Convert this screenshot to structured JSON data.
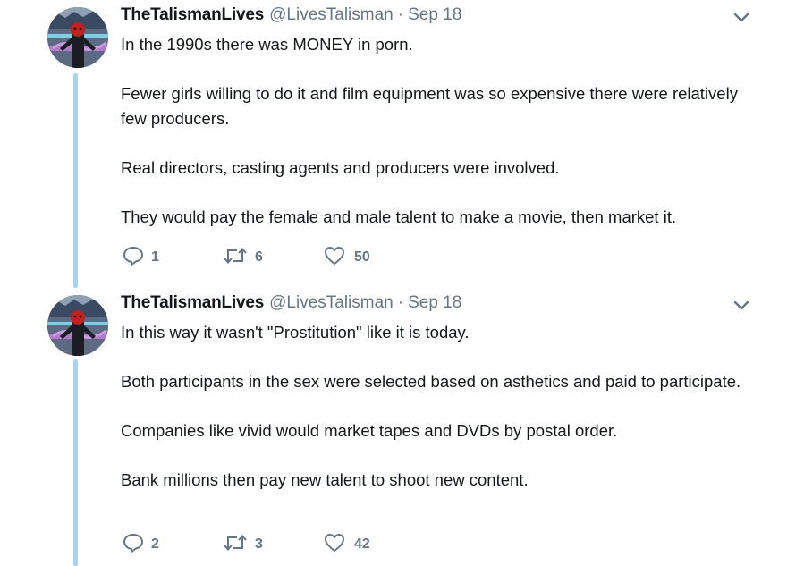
{
  "tweets": [
    {
      "display_name": "TheTalismanLives",
      "handle": "@LivesTalisman",
      "separator": "·",
      "date": "Sep 18",
      "paragraphs": [
        "In the 1990s there was MONEY in porn.",
        "Fewer girls willing to do it and film equipment was so expensive there were relatively few producers.",
        "Real directors, casting agents and producers were involved.",
        "They would pay the female and male talent to make a movie, then market it."
      ],
      "replies": "1",
      "retweets": "6",
      "likes": "50"
    },
    {
      "display_name": "TheTalismanLives",
      "handle": "@LivesTalisman",
      "separator": "·",
      "date": "Sep 18",
      "paragraphs": [
        "In this way it wasn't \"Prostitution\" like it is today.",
        "Both participants in the sex were selected based on asthetics and paid to participate.",
        "Companies like vivid would market tapes and DVDs by postal order.",
        "Bank millions then pay new talent to shoot new content."
      ],
      "replies": "2",
      "retweets": "3",
      "likes": "42"
    }
  ],
  "icons": {
    "reply": "reply-icon",
    "retweet": "retweet-icon",
    "like": "heart-icon",
    "menu": "chevron-down-icon"
  },
  "colors": {
    "thread_line": "#a9d4ee",
    "secondary_text": "#657786",
    "primary_text": "#14171a"
  }
}
